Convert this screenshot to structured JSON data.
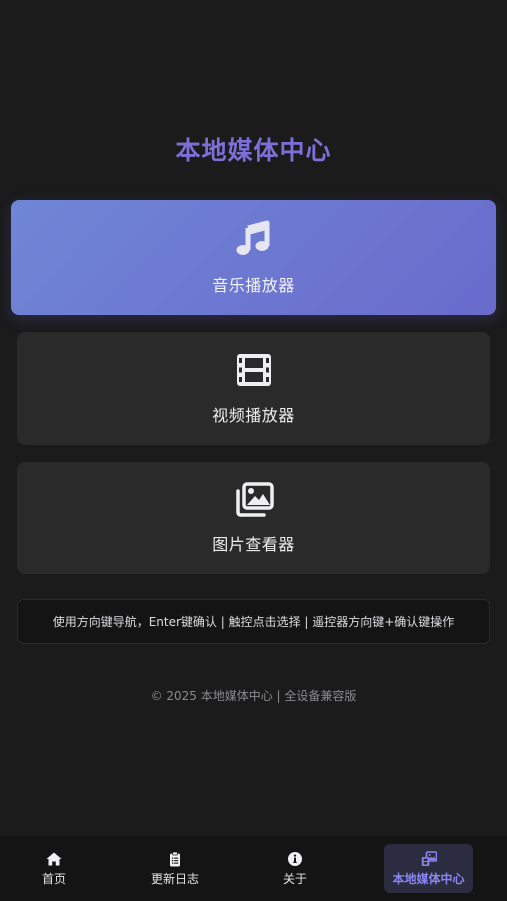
{
  "app": {
    "title": "本地媒体中心"
  },
  "cards": [
    {
      "label": "音乐播放器",
      "icon": "music-note-icon",
      "selected": true
    },
    {
      "label": "视频播放器",
      "icon": "film-icon",
      "selected": false
    },
    {
      "label": "图片查看器",
      "icon": "images-icon",
      "selected": false
    }
  ],
  "hint": "使用方向键导航，Enter键确认 | 触控点击选择 | 遥控器方向键+确认键操作",
  "footer": "© 2025 本地媒体中心 | 全设备兼容版",
  "nav": [
    {
      "label": "首页",
      "icon": "home-icon",
      "active": false
    },
    {
      "label": "更新日志",
      "icon": "clipboard-list-icon",
      "active": false
    },
    {
      "label": "关于",
      "icon": "info-circle-icon",
      "active": false
    },
    {
      "label": "本地媒体中心",
      "icon": "photo-film-icon",
      "active": true
    }
  ],
  "colors": {
    "background": "#1b1b1c",
    "title": "#7c70d8",
    "accent_gradient_start": "#6f86d6",
    "accent_gradient_end": "#6a6bcc",
    "card": "#2a2a2b",
    "nav_active_text": "#8a86f0"
  }
}
